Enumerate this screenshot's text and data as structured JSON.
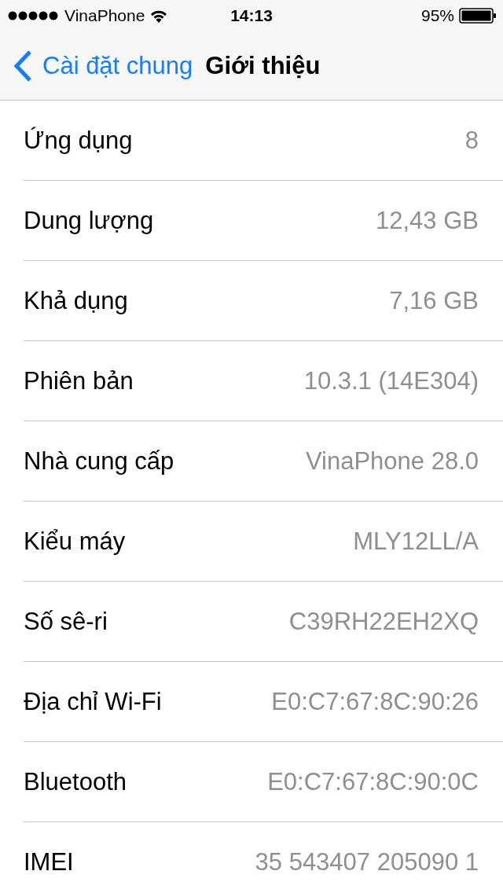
{
  "status_bar": {
    "carrier": "VinaPhone",
    "time": "14:13",
    "battery": "95%"
  },
  "nav_bar": {
    "back_label": "Cài đặt chung",
    "title": "Giới thiệu"
  },
  "rows": [
    {
      "label": "Ứng dụng",
      "value": "8"
    },
    {
      "label": "Dung lượng",
      "value": "12,43 GB"
    },
    {
      "label": "Khả dụng",
      "value": "7,16 GB"
    },
    {
      "label": "Phiên bản",
      "value": "10.3.1 (14E304)"
    },
    {
      "label": "Nhà cung cấp",
      "value": "VinaPhone 28.0"
    },
    {
      "label": "Kiểu máy",
      "value": "MLY12LL/A"
    },
    {
      "label": "Số sê-ri",
      "value": "C39RH22EH2XQ"
    },
    {
      "label": "Địa chỉ Wi-Fi",
      "value": "E0:C7:67:8C:90:26"
    },
    {
      "label": "Bluetooth",
      "value": "E0:C7:67:8C:90:0C"
    },
    {
      "label": "IMEI",
      "value": "35 543407 205090 1"
    }
  ]
}
